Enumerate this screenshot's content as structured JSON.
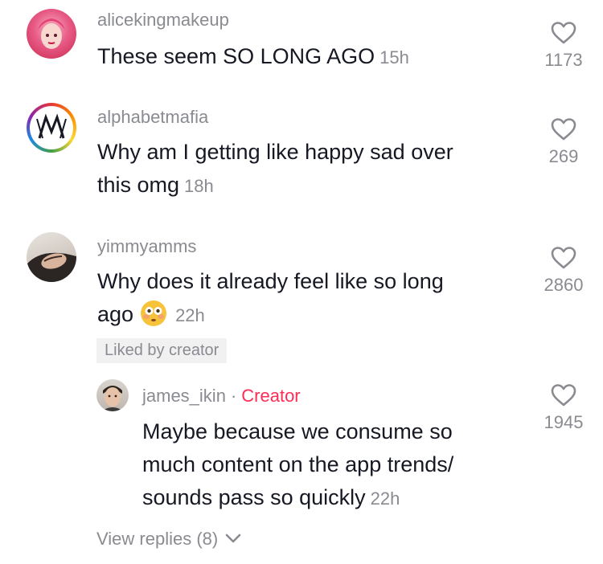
{
  "comments": [
    {
      "username": "alicekingmakeup",
      "text": "These seem SO LONG AGO",
      "time": "15h",
      "likes": "1173"
    },
    {
      "username": "alphabetmafia",
      "text_line1": "Why am I getting like happy sad over",
      "text_line2": "this omg",
      "time": "18h",
      "likes": "269"
    },
    {
      "username": "yimmyamms",
      "text_line1": "Why does it already feel like so long",
      "text_line2": "ago",
      "emoji": "flushed-face",
      "time": "22h",
      "likes": "2860",
      "badge": "Liked by creator"
    }
  ],
  "reply": {
    "username": "james_ikin",
    "separator": "·",
    "role": "Creator",
    "text_line1": "Maybe because we consume so",
    "text_line2": "much content on the app trends/",
    "text_line3": "sounds pass so quickly",
    "time": "22h",
    "likes": "1945"
  },
  "view_replies": "View replies (8)",
  "icons": {
    "like": "heart-outline-icon",
    "expand": "chevron-down-icon"
  },
  "colors": {
    "text": "#161823",
    "secondary": "#8a8b91",
    "creator": "#fe2c55",
    "badge_bg": "#f1f1f2"
  }
}
